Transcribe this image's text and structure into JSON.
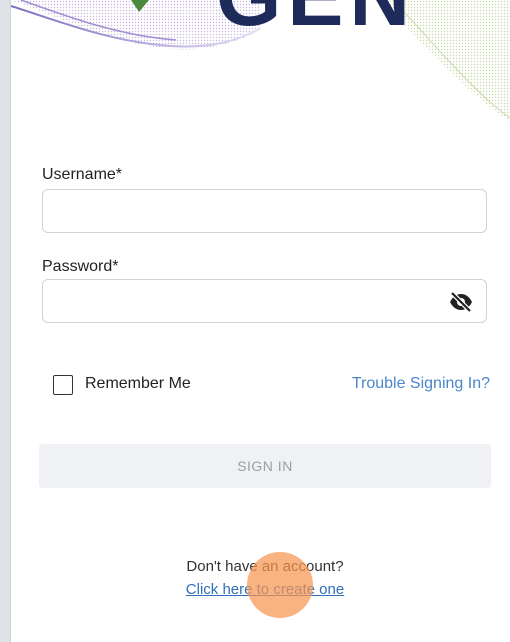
{
  "logo": {
    "text": "GEN"
  },
  "form": {
    "username": {
      "label": "Username*",
      "value": "",
      "placeholder": ""
    },
    "password": {
      "label": "Password*",
      "value": "",
      "placeholder": ""
    },
    "remember_me": {
      "label": "Remember Me",
      "checked": false
    },
    "trouble_link": "Trouble Signing In?",
    "sign_in_label": "SIGN IN"
  },
  "footer": {
    "prompt": "Don't have an account?",
    "create_link": "Click here to create one"
  },
  "colors": {
    "brand_navy": "#1e2b5a",
    "link_blue": "#4a86c8",
    "click_marker": "#f79650"
  },
  "icons": {
    "password_toggle": "eye-slash-icon"
  }
}
